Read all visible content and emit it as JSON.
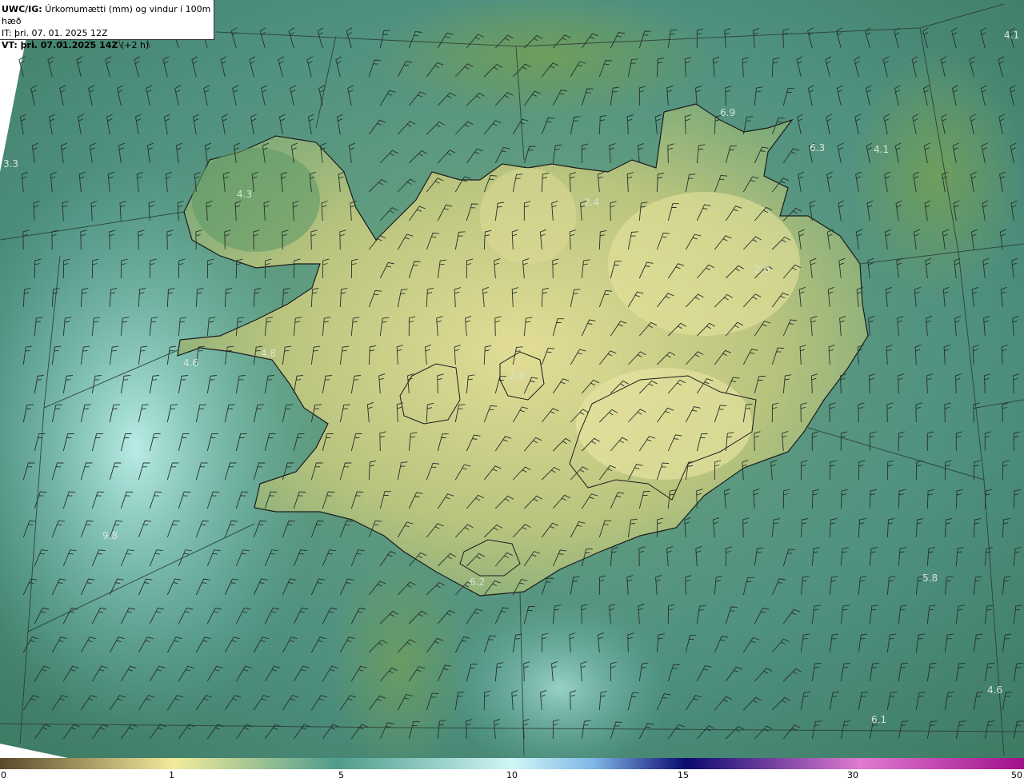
{
  "header": {
    "product": "UWC/IG:",
    "title": "Úrkomumætti (mm) og vindur í 100m hæð",
    "init_label": "IT:",
    "init_time": "þri. 07. 01. 2025 12Z",
    "valid_label": "VT: þri. 07.01.2025 14Z",
    "lead": "(+2 h)"
  },
  "value_labels": [
    {
      "id": "v1",
      "text": "4.1"
    },
    {
      "id": "v2",
      "text": "6.9"
    },
    {
      "id": "v3",
      "text": "6.3"
    },
    {
      "id": "v4",
      "text": "4.1"
    },
    {
      "id": "v5",
      "text": "3.3"
    },
    {
      "id": "v6",
      "text": "4.3"
    },
    {
      "id": "v7",
      "text": "2.4"
    },
    {
      "id": "v8",
      "text": "2.0"
    },
    {
      "id": "v9",
      "text": "4.8"
    },
    {
      "id": "v10",
      "text": "4.6"
    },
    {
      "id": "v11",
      "text": "2.6"
    },
    {
      "id": "v12",
      "text": "9.8"
    },
    {
      "id": "v13",
      "text": "6.2"
    },
    {
      "id": "v14",
      "text": "5.8"
    },
    {
      "id": "v15",
      "text": "4.6"
    },
    {
      "id": "v16",
      "text": "6.1"
    }
  ],
  "colorbar": {
    "ticks": [
      "0",
      "1",
      "5",
      "10",
      "15",
      "30",
      "50"
    ],
    "colors": [
      "#5a4a2c",
      "#b8ad6e",
      "#f2ec9a",
      "#4f9c8c",
      "#cff6f6",
      "#7fb6e6",
      "#2a2aa0",
      "#0a0a70",
      "#8a3a90",
      "#e07ad0",
      "#f0a8e8",
      "#b0108a"
    ]
  },
  "colors": {
    "land_low": "#c9cf88",
    "land_high": "#e3e09a",
    "sea_deep": "#3f8070",
    "sea_light": "#a6e2dc",
    "green_mid": "#5a9a70"
  }
}
